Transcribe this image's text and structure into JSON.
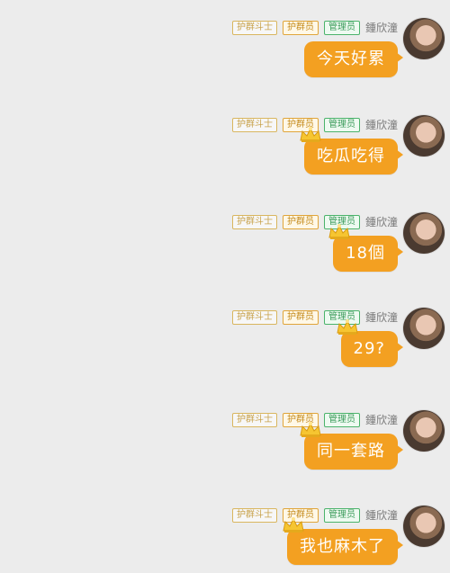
{
  "messages": [
    {
      "name": "鍾欣潼",
      "badges": [
        "护群斗士",
        "护群员",
        "管理员"
      ],
      "text": "今天好累"
    },
    {
      "name": "鍾欣潼",
      "badges": [
        "护群斗士",
        "护群员",
        "管理员"
      ],
      "text": "吃瓜吃得"
    },
    {
      "name": "鍾欣潼",
      "badges": [
        "护群斗士",
        "护群员",
        "管理员"
      ],
      "text": "18個"
    },
    {
      "name": "鍾欣潼",
      "badges": [
        "护群斗士",
        "护群员",
        "管理员"
      ],
      "text": "29?"
    },
    {
      "name": "鍾欣潼",
      "badges": [
        "护群斗士",
        "护群员",
        "管理员"
      ],
      "text": "同一套路"
    },
    {
      "name": "鍾欣潼",
      "badges": [
        "护群斗士",
        "护群员",
        "管理员"
      ],
      "text": "我也麻木了"
    }
  ],
  "colors": {
    "bubble": "#f3a021",
    "background": "#ececec",
    "admin": "#4bb36b"
  },
  "icons": {
    "crown": "crown-icon",
    "avatar": "user-avatar"
  }
}
